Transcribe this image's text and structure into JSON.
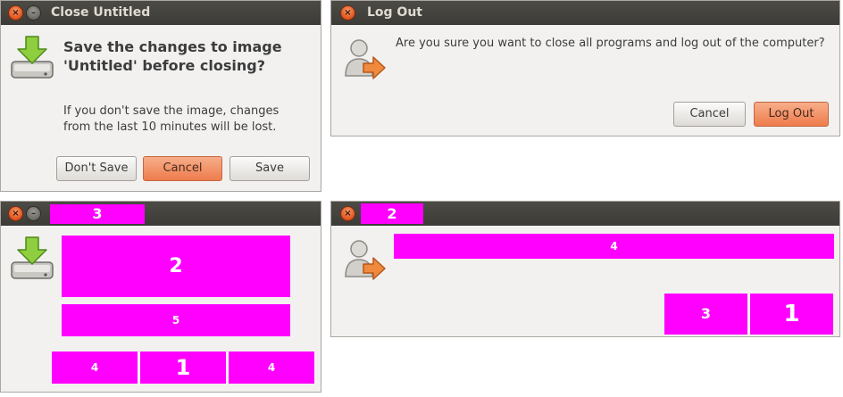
{
  "close_dialog": {
    "title": "Close Untitled",
    "close_button_glyph": "×",
    "minimize_button_glyph": "–",
    "heading": "Save the changes to image 'Untitled' before closing?",
    "message": "If you don't save the image, changes from the last 10 minutes will be lost.",
    "buttons": {
      "dont_save": "Don't Save",
      "cancel": "Cancel",
      "save": "Save"
    },
    "icon": "drive-download-icon"
  },
  "logout_dialog": {
    "title": "Log Out",
    "close_button_glyph": "×",
    "message": "Are you sure you want to close all programs and log out of the computer?",
    "buttons": {
      "cancel": "Cancel",
      "logout": "Log Out"
    },
    "icon": "user-logout-icon"
  },
  "masked_close_dialog": {
    "close_button_glyph": "×",
    "minimize_button_glyph": "–",
    "labels": {
      "title": "3",
      "heading": "2",
      "message": "5",
      "dont_save_button": "4",
      "cancel_button": "1",
      "save_button": "4"
    },
    "icon": "drive-download-icon"
  },
  "masked_logout_dialog": {
    "close_button_glyph": "×",
    "labels": {
      "title": "2",
      "message": "4",
      "cancel_button": "3",
      "logout_button": "1"
    },
    "icon": "user-logout-icon"
  },
  "colors": {
    "mask": "#ff00ff",
    "accent_button": "#f08a5d",
    "titlebar": "#3c3b37",
    "window_bg": "#f2f1f0"
  }
}
